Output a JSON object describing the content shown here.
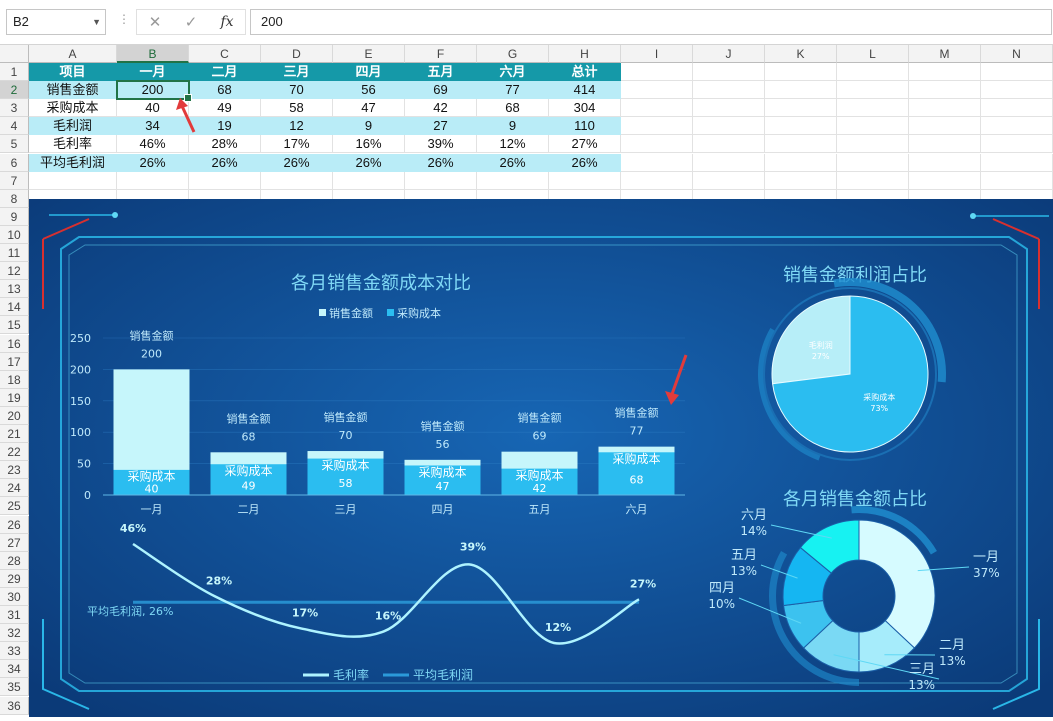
{
  "formula_bar": {
    "cell_ref": "B2",
    "cancel_icon": "✕",
    "enter_icon": "✓",
    "fx_label": "fx",
    "value": "200"
  },
  "columns": [
    "A",
    "B",
    "C",
    "D",
    "E",
    "F",
    "G",
    "H",
    "I",
    "J",
    "K",
    "L",
    "M",
    "N"
  ],
  "rows": [
    "1",
    "2",
    "3",
    "4",
    "5",
    "6",
    "7",
    "8",
    "9",
    "10",
    "11",
    "12",
    "13",
    "14",
    "15",
    "16",
    "17",
    "18",
    "19",
    "20",
    "21",
    "22",
    "23",
    "24",
    "25",
    "26",
    "27",
    "28",
    "29",
    "30",
    "31",
    "32",
    "33",
    "34",
    "35",
    "36"
  ],
  "table": {
    "header": [
      "项目",
      "一月",
      "二月",
      "三月",
      "四月",
      "五月",
      "六月",
      "总计"
    ],
    "rows": [
      [
        "销售金额",
        "200",
        "68",
        "70",
        "56",
        "69",
        "77",
        "414"
      ],
      [
        "采购成本",
        "40",
        "49",
        "58",
        "47",
        "42",
        "68",
        "304"
      ],
      [
        "毛利润",
        "34",
        "19",
        "12",
        "9",
        "27",
        "9",
        "110"
      ],
      [
        "毛利率",
        "46%",
        "28%",
        "17%",
        "16%",
        "39%",
        "12%",
        "27%"
      ],
      [
        "平均毛利润",
        "26%",
        "26%",
        "26%",
        "26%",
        "26%",
        "26%",
        "26%"
      ]
    ]
  },
  "colors": {
    "accent": "#1599a8",
    "band": "#b9ecf7",
    "panel": "#0f4f93",
    "sales": "#c6f6fb",
    "cost": "#2bbdf0",
    "arrow": "#e23b3b"
  },
  "bar_chart": {
    "title": "各月销售金额成本对比",
    "legend": [
      "销售金额",
      "采购成本"
    ],
    "sales_label": "销售金额",
    "cost_label": "采购成本",
    "chart_data": {
      "type": "bar",
      "stacked": true,
      "categories": [
        "一月",
        "二月",
        "三月",
        "四月",
        "五月",
        "六月"
      ],
      "series": [
        {
          "name": "销售金额",
          "values": [
            200,
            68,
            70,
            56,
            69,
            77
          ]
        },
        {
          "name": "采购成本",
          "values": [
            40,
            49,
            58,
            47,
            42,
            68
          ]
        }
      ],
      "ylim": [
        0,
        250
      ],
      "yticks": [
        "0",
        "50",
        "100",
        "150",
        "200",
        "250"
      ]
    }
  },
  "line_chart": {
    "legend": [
      "毛利率",
      "平均毛利润"
    ],
    "avg_label": "平均毛利润, 26%",
    "chart_data": {
      "type": "line",
      "categories": [
        "一月",
        "二月",
        "三月",
        "四月",
        "五月",
        "六月"
      ],
      "series": [
        {
          "name": "毛利率",
          "values": [
            46,
            28,
            17,
            16,
            39,
            12,
            27
          ],
          "labels": [
            "46%",
            "28%",
            "17%",
            "16%",
            "39%",
            "12%",
            "27%"
          ]
        },
        {
          "name": "平均毛利润",
          "value": 26
        }
      ]
    }
  },
  "pie_chart": {
    "title": "销售金额利润占比",
    "chart_data": {
      "type": "pie",
      "slices": [
        {
          "name": "毛利润",
          "value": 27,
          "label": "27%"
        },
        {
          "name": "采购成本",
          "value": 73,
          "label": "73%"
        }
      ]
    }
  },
  "donut_chart": {
    "title": "各月销售金额占比",
    "chart_data": {
      "type": "pie",
      "hole": true,
      "slices": [
        {
          "name": "一月",
          "value": 37,
          "label": "37%"
        },
        {
          "name": "二月",
          "value": 13,
          "label": "13%"
        },
        {
          "name": "三月",
          "value": 13,
          "label": "13%"
        },
        {
          "name": "四月",
          "value": 10,
          "label": "10%"
        },
        {
          "name": "五月",
          "value": 13,
          "label": "13%"
        },
        {
          "name": "六月",
          "value": 14,
          "label": "14%"
        }
      ]
    }
  }
}
